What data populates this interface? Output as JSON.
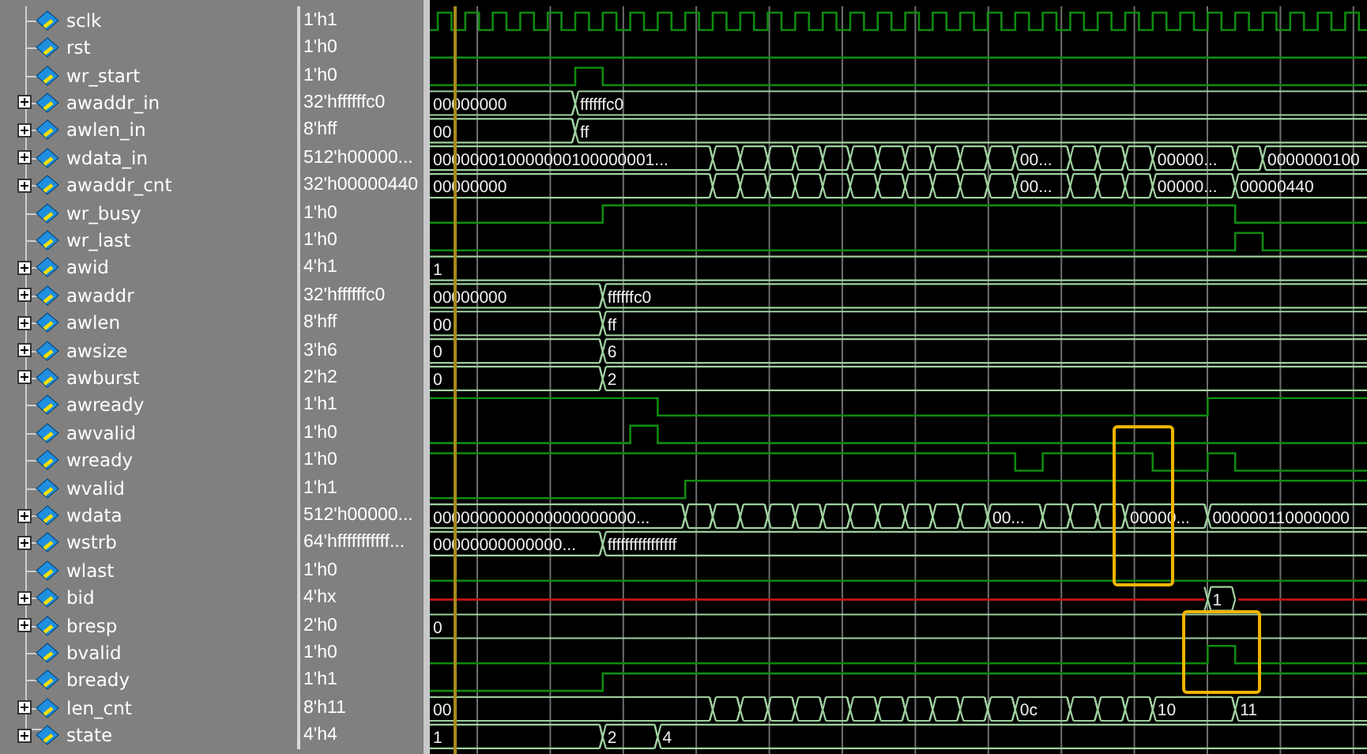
{
  "signals": [
    {
      "name": "sclk",
      "value": "1'h1",
      "expandable": false,
      "kind": "clock"
    },
    {
      "name": "rst",
      "value": "1'h0",
      "expandable": false,
      "kind": "bit"
    },
    {
      "name": "wr_start",
      "value": "1'h0",
      "expandable": false,
      "kind": "bit"
    },
    {
      "name": "awaddr_in",
      "value": "32'hffffffc0",
      "expandable": true,
      "kind": "bus",
      "labels": [
        "00000000",
        "ffffffc0"
      ]
    },
    {
      "name": "awlen_in",
      "value": "8'hff",
      "expandable": true,
      "kind": "bus",
      "labels": [
        "00",
        "ff"
      ]
    },
    {
      "name": "wdata_in",
      "value": "512'h00000...",
      "expandable": true,
      "kind": "bus",
      "labels": [
        "000000010000000100000001...",
        "00...",
        "00000...",
        "0000000100"
      ]
    },
    {
      "name": "awaddr_cnt",
      "value": "32'h00000440",
      "expandable": true,
      "kind": "bus",
      "labels": [
        "00000000",
        "00...",
        "00000...",
        "00000440"
      ]
    },
    {
      "name": "wr_busy",
      "value": "1'h0",
      "expandable": false,
      "kind": "bit"
    },
    {
      "name": "wr_last",
      "value": "1'h0",
      "expandable": false,
      "kind": "bit"
    },
    {
      "name": "awid",
      "value": "4'h1",
      "expandable": true,
      "kind": "bus",
      "labels": [
        "1"
      ]
    },
    {
      "name": "awaddr",
      "value": "32'hffffffc0",
      "expandable": true,
      "kind": "bus",
      "labels": [
        "00000000",
        "ffffffc0"
      ]
    },
    {
      "name": "awlen",
      "value": "8'hff",
      "expandable": true,
      "kind": "bus",
      "labels": [
        "00",
        "ff"
      ]
    },
    {
      "name": "awsize",
      "value": "3'h6",
      "expandable": true,
      "kind": "bus",
      "labels": [
        "0",
        "6"
      ]
    },
    {
      "name": "awburst",
      "value": "2'h2",
      "expandable": true,
      "kind": "bus",
      "labels": [
        "0",
        "2"
      ]
    },
    {
      "name": "awready",
      "value": "1'h1",
      "expandable": false,
      "kind": "bit"
    },
    {
      "name": "awvalid",
      "value": "1'h0",
      "expandable": false,
      "kind": "bit"
    },
    {
      "name": "wready",
      "value": "1'h0",
      "expandable": false,
      "kind": "bit"
    },
    {
      "name": "wvalid",
      "value": "1'h1",
      "expandable": false,
      "kind": "bit"
    },
    {
      "name": "wdata",
      "value": "512'h00000...",
      "expandable": true,
      "kind": "bus",
      "labels": [
        "0000000000000000000000...",
        "00...",
        "00000...",
        "000000110000000"
      ]
    },
    {
      "name": "wstrb",
      "value": "64'hfffffffffff...",
      "expandable": true,
      "kind": "bus",
      "labels": [
        "00000000000000...",
        "ffffffffffffffff"
      ]
    },
    {
      "name": "wlast",
      "value": "1'h0",
      "expandable": false,
      "kind": "bit"
    },
    {
      "name": "bid",
      "value": "4'hx",
      "expandable": true,
      "kind": "bus",
      "labels": [
        "1"
      ]
    },
    {
      "name": "bresp",
      "value": "2'h0",
      "expandable": true,
      "kind": "bus",
      "labels": [
        "0"
      ]
    },
    {
      "name": "bvalid",
      "value": "1'h0",
      "expandable": false,
      "kind": "bit"
    },
    {
      "name": "bready",
      "value": "1'h1",
      "expandable": false,
      "kind": "bit"
    },
    {
      "name": "len_cnt",
      "value": "8'h11",
      "expandable": true,
      "kind": "bus",
      "labels": [
        "00",
        "0c",
        "10",
        "11"
      ]
    },
    {
      "name": "state",
      "value": "4'h4",
      "expandable": true,
      "kind": "bus",
      "labels": [
        "1",
        "2",
        "4"
      ]
    }
  ]
}
